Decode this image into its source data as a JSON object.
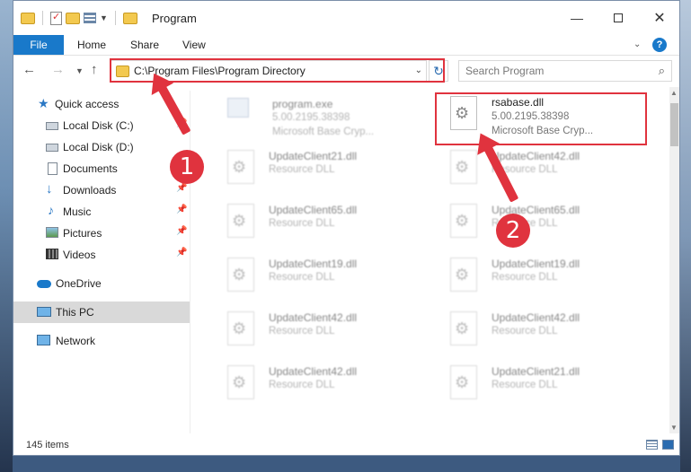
{
  "window": {
    "title": "Program"
  },
  "ribbon": {
    "tabs": [
      {
        "label": "File"
      },
      {
        "label": "Home"
      },
      {
        "label": "Share"
      },
      {
        "label": "View"
      }
    ],
    "help": "?"
  },
  "nav": {
    "address": "C:\\Program Files\\Program Directory",
    "search_placeholder": "Search Program"
  },
  "sidebar": {
    "items": [
      {
        "label": "Quick access",
        "icon": "star-icon"
      },
      {
        "label": "Local Disk (C:)",
        "icon": "drive-icon"
      },
      {
        "label": "Local Disk (D:)",
        "icon": "drive-icon"
      },
      {
        "label": "Documents",
        "icon": "document-icon"
      },
      {
        "label": "Downloads",
        "icon": "download-icon"
      },
      {
        "label": "Music",
        "icon": "music-icon"
      },
      {
        "label": "Pictures",
        "icon": "picture-icon"
      },
      {
        "label": "Videos",
        "icon": "video-icon"
      },
      {
        "label": "OneDrive",
        "icon": "cloud-icon"
      },
      {
        "label": "This PC",
        "icon": "computer-icon"
      },
      {
        "label": "Network",
        "icon": "network-icon"
      }
    ]
  },
  "files": [
    {
      "name": "program.exe",
      "line1": "5.00.2195.38398",
      "line2": "Microsoft Base Cryp..."
    },
    {
      "name": "rsabase.dll",
      "line1": "5.00.2195.38398",
      "line2": "Microsoft Base Cryp..."
    },
    {
      "name": "UpdateClient21.dll",
      "line1": "Resource DLL"
    },
    {
      "name": "UpdateClient42.dll",
      "line1": "Resource DLL"
    },
    {
      "name": "UpdateClient65.dll",
      "line1": "Resource DLL"
    },
    {
      "name": "UpdateClient65.dll",
      "line1": "Resource DLL"
    },
    {
      "name": "UpdateClient19.dll",
      "line1": "Resource DLL"
    },
    {
      "name": "UpdateClient19.dll",
      "line1": "Resource DLL"
    },
    {
      "name": "UpdateClient42.dll",
      "line1": "Resource DLL"
    },
    {
      "name": "UpdateClient42.dll",
      "line1": "Resource DLL"
    },
    {
      "name": "UpdateClient42.dll",
      "line1": "Resource DLL"
    },
    {
      "name": "UpdateClient21.dll",
      "line1": "Resource DLL"
    }
  ],
  "annotations": {
    "badge1": "1",
    "badge2": "2",
    "color": "#e0333e"
  },
  "status": {
    "count": "145 items"
  },
  "colors": {
    "accent": "#1979ca",
    "folder": "#f3c94f"
  }
}
